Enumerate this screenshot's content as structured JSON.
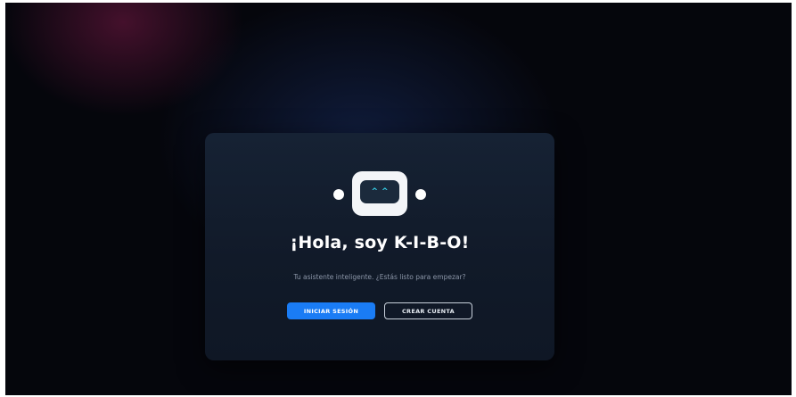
{
  "robot": {
    "icon": "robot-icon",
    "eyes": [
      "^",
      "^"
    ],
    "eye_color": "#38d9f0"
  },
  "welcome": {
    "title": "¡Hola, soy K-I-B-O!",
    "subtitle": "Tu asistente inteligente. ¿Estás listo para empezar?"
  },
  "actions": {
    "login_label": "INICIAR SESIÓN",
    "register_label": "CREAR CUENTA"
  },
  "colors": {
    "primary": "#1a7cf5",
    "background": "#05060c",
    "card": "#131d2d"
  }
}
